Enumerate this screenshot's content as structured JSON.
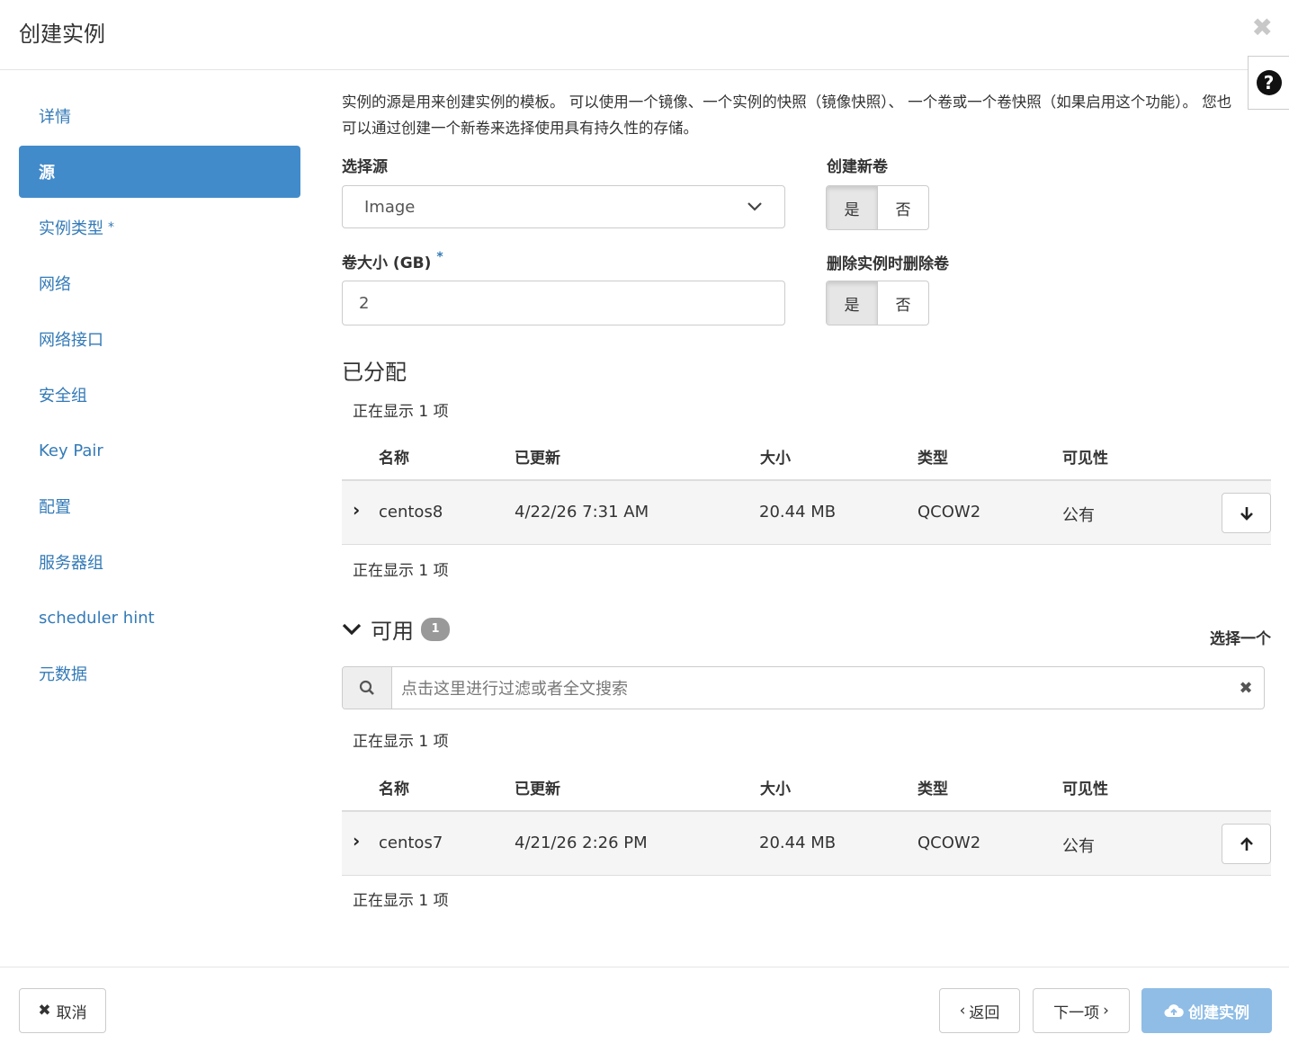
{
  "modal": {
    "title": "创建实例",
    "close": "✖",
    "help": "?"
  },
  "nav": {
    "items": [
      {
        "label": "详情"
      },
      {
        "label": "源"
      },
      {
        "label": "实例类型",
        "required": "*"
      },
      {
        "label": "网络"
      },
      {
        "label": "网络接口"
      },
      {
        "label": "安全组"
      },
      {
        "label": "Key Pair"
      },
      {
        "label": "配置"
      },
      {
        "label": "服务器组"
      },
      {
        "label": "scheduler hint"
      },
      {
        "label": "元数据"
      }
    ]
  },
  "source": {
    "intro": "实例的源是用来创建实例的模板。 可以使用一个镜像、一个实例的快照（镜像快照）、 一个卷或一个卷快照（如果启用这个功能）。 您也可以通过创建一个新卷来选择使用具有持久性的存储。",
    "select_source_label": "选择源",
    "select_source_value": "Image",
    "create_volume_label": "创建新卷",
    "volume_size_label": "卷大小 (GB)",
    "volume_size_required": "*",
    "volume_size_value": "2",
    "delete_volume_label": "删除实例时删除卷",
    "yes": "是",
    "no": "否"
  },
  "allocated": {
    "title": "已分配",
    "count_text": "正在显示 1 项",
    "columns": [
      "名称",
      "已更新",
      "大小",
      "类型",
      "可见性"
    ],
    "rows": [
      {
        "name": "centos8",
        "updated": "4/22/26 7:31 AM",
        "size": "20.44 MB",
        "type": "QCOW2",
        "visibility": "公有"
      }
    ]
  },
  "available": {
    "title": "可用",
    "badge": "1",
    "select_one": "选择一个",
    "search_placeholder": "点击这里进行过滤或者全文搜索",
    "count_text": "正在显示 1 项",
    "columns": [
      "名称",
      "已更新",
      "大小",
      "类型",
      "可见性"
    ],
    "rows": [
      {
        "name": "centos7",
        "updated": "4/21/26 2:26 PM",
        "size": "20.44 MB",
        "type": "QCOW2",
        "visibility": "公有"
      }
    ]
  },
  "footer": {
    "cancel": "取消",
    "back": "返回",
    "next": "下一项",
    "create": "创建实例"
  },
  "colors": {
    "primary": "#428bca",
    "link": "#337ab7",
    "primary_disabled": "#8fbde6"
  }
}
